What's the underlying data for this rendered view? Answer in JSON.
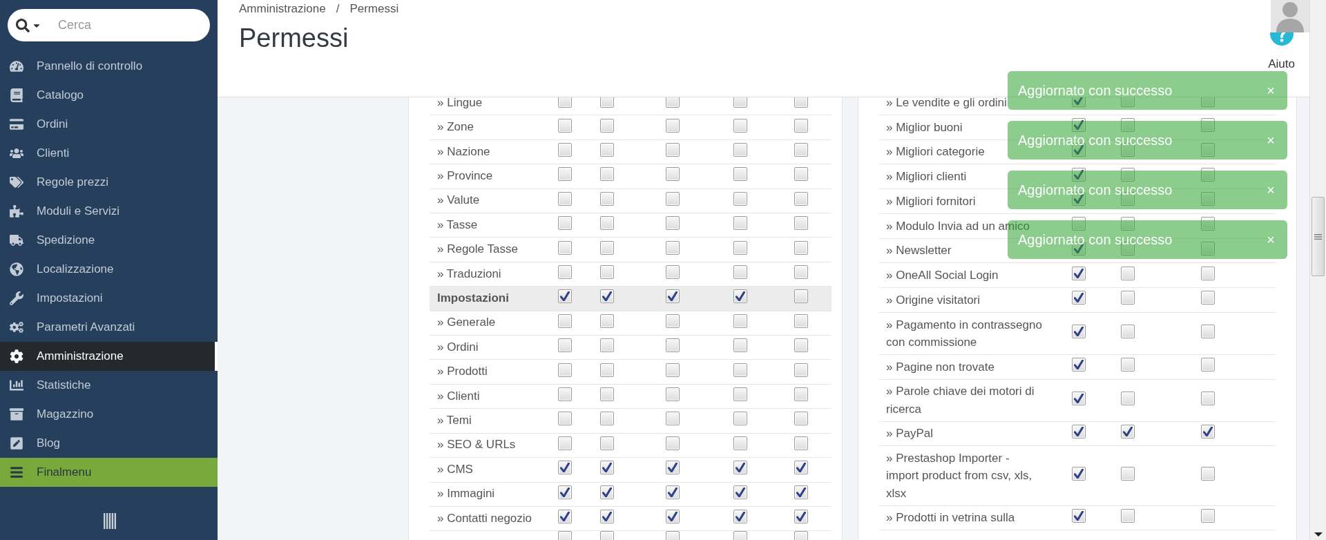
{
  "sidebar": {
    "search": {
      "placeholder": "Cerca"
    },
    "items": [
      {
        "label": "Pannello di controllo",
        "selected": false,
        "hovered": false
      },
      {
        "label": "Catalogo",
        "selected": false,
        "hovered": false
      },
      {
        "label": "Ordini",
        "selected": false,
        "hovered": false
      },
      {
        "label": "Clienti",
        "selected": false,
        "hovered": false
      },
      {
        "label": "Regole prezzi",
        "selected": false,
        "hovered": false
      },
      {
        "label": "Moduli e Servizi",
        "selected": false,
        "hovered": false
      },
      {
        "label": "Spedizione",
        "selected": false,
        "hovered": false
      },
      {
        "label": "Localizzazione",
        "selected": false,
        "hovered": false
      },
      {
        "label": "Impostazioni",
        "selected": false,
        "hovered": false
      },
      {
        "label": "Parametri Avanzati",
        "selected": false,
        "hovered": false
      },
      {
        "label": "Amministrazione",
        "selected": true,
        "hovered": false
      },
      {
        "label": "Statistiche",
        "selected": false,
        "hovered": false
      },
      {
        "label": "Magazzino",
        "selected": false,
        "hovered": false
      },
      {
        "label": "Blog",
        "selected": false,
        "hovered": false
      },
      {
        "label": "Finalmenu",
        "selected": false,
        "hovered": true
      }
    ]
  },
  "header": {
    "breadcrumb": {
      "items": [
        "Amministrazione",
        "Permessi"
      ],
      "separator": "/"
    },
    "title": "Permessi",
    "help": {
      "label": "Aiuto"
    }
  },
  "permissions_left": {
    "rows": [
      {
        "kind": "item",
        "label": "» Lingue",
        "checks": [
          false,
          false,
          false,
          false,
          false
        ]
      },
      {
        "kind": "item",
        "label": "» Zone",
        "checks": [
          false,
          false,
          false,
          false,
          false
        ]
      },
      {
        "kind": "item",
        "label": "» Nazione",
        "checks": [
          false,
          false,
          false,
          false,
          false
        ]
      },
      {
        "kind": "item",
        "label": "» Province",
        "checks": [
          false,
          false,
          false,
          false,
          false
        ]
      },
      {
        "kind": "item",
        "label": "» Valute",
        "checks": [
          false,
          false,
          false,
          false,
          false
        ]
      },
      {
        "kind": "item",
        "label": "» Tasse",
        "checks": [
          false,
          false,
          false,
          false,
          false
        ]
      },
      {
        "kind": "item",
        "label": "» Regole Tasse",
        "checks": [
          false,
          false,
          false,
          false,
          false
        ]
      },
      {
        "kind": "item",
        "label": "» Traduzioni",
        "checks": [
          false,
          false,
          false,
          false,
          false
        ]
      },
      {
        "kind": "section",
        "label": "Impostazioni",
        "checks": [
          true,
          true,
          true,
          true,
          false
        ]
      },
      {
        "kind": "item",
        "label": "» Generale",
        "checks": [
          false,
          false,
          false,
          false,
          false
        ]
      },
      {
        "kind": "item",
        "label": "» Ordini",
        "checks": [
          false,
          false,
          false,
          false,
          false
        ]
      },
      {
        "kind": "item",
        "label": "» Prodotti",
        "checks": [
          false,
          false,
          false,
          false,
          false
        ]
      },
      {
        "kind": "item",
        "label": "» Clienti",
        "checks": [
          false,
          false,
          false,
          false,
          false
        ]
      },
      {
        "kind": "item",
        "label": "» Temi",
        "checks": [
          false,
          false,
          false,
          false,
          false
        ]
      },
      {
        "kind": "item",
        "label": "» SEO & URLs",
        "checks": [
          false,
          false,
          false,
          false,
          false
        ]
      },
      {
        "kind": "item",
        "label": "» CMS",
        "checks": [
          true,
          true,
          true,
          true,
          true
        ]
      },
      {
        "kind": "item",
        "label": "» Immagini",
        "checks": [
          true,
          true,
          true,
          true,
          true
        ]
      },
      {
        "kind": "item",
        "label": "» Contatti negozio",
        "checks": [
          true,
          true,
          true,
          true,
          true
        ]
      },
      {
        "kind": "item",
        "checks": [
          false,
          false,
          false,
          false,
          false
        ]
      }
    ]
  },
  "permissions_right": {
    "rows": [
      {
        "kind": "item",
        "label": "» Le vendite e gli ordini",
        "checks": [
          true,
          false,
          false
        ]
      },
      {
        "kind": "item",
        "label": "» Miglior buoni",
        "checks": [
          true,
          false,
          false
        ]
      },
      {
        "kind": "item",
        "label": "» Migliori categorie",
        "checks": [
          true,
          false,
          false
        ]
      },
      {
        "kind": "item",
        "label": "» Migliori clienti",
        "checks": [
          true,
          false,
          false
        ]
      },
      {
        "kind": "item",
        "label": "» Migliori fornitori",
        "checks": [
          true,
          false,
          false
        ]
      },
      {
        "kind": "item",
        "label": "» Modulo Invia ad un amico",
        "checks": [
          false,
          false,
          false
        ]
      },
      {
        "kind": "item",
        "label": "» Newsletter",
        "checks": [
          true,
          false,
          false
        ]
      },
      {
        "kind": "item",
        "label": "» OneAll Social Login",
        "checks": [
          true,
          false,
          false
        ]
      },
      {
        "kind": "item",
        "label": "» Origine visitatori",
        "checks": [
          true,
          false,
          false
        ]
      },
      {
        "kind": "item",
        "label": "» Pagamento in contrassegno con commissione",
        "checks": [
          true,
          false,
          false
        ]
      },
      {
        "kind": "item",
        "label": "» Pagine non trovate",
        "checks": [
          true,
          false,
          false
        ]
      },
      {
        "kind": "item",
        "label": "» Parole chiave dei motori di ricerca",
        "checks": [
          true,
          false,
          false
        ]
      },
      {
        "kind": "item",
        "label": "» PayPal",
        "checks": [
          true,
          true,
          true
        ]
      },
      {
        "kind": "item",
        "label": "» Prestashop Importer - import product from csv, xls, xlsx",
        "checks": [
          true,
          false,
          false
        ]
      },
      {
        "kind": "item",
        "label": "» Prodotti in vetrina sulla",
        "checks": [
          true,
          false,
          false
        ]
      }
    ]
  },
  "notifications": [
    {
      "message": "Aggiornato con successo",
      "close": "×"
    },
    {
      "message": "Aggiornato con successo",
      "close": "×"
    },
    {
      "message": "Aggiornato con successo",
      "close": "×"
    },
    {
      "message": "Aggiornato con successo",
      "close": "×"
    }
  ]
}
